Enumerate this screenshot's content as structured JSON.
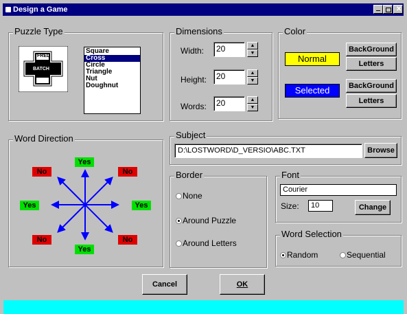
{
  "window": {
    "title": "Design a Game"
  },
  "puzzle_type": {
    "legend": "Puzzle Type",
    "preview_words": [
      "FRED",
      "BATCH"
    ],
    "options": [
      "Square",
      "Cross",
      "Circle",
      "Triangle",
      "Nut",
      "Doughnut"
    ],
    "selected": "Cross"
  },
  "dimensions": {
    "legend": "Dimensions",
    "width_label": "Width:",
    "width_value": "20",
    "height_label": "Height:",
    "height_value": "20",
    "words_label": "Words:",
    "words_value": "20"
  },
  "color": {
    "legend": "Color",
    "normal_label": "Normal",
    "selected_label": "Selected",
    "background_btn": "BackGround",
    "letters_btn": "Letters",
    "normal_color": "#ffff00",
    "selected_color": "#0000ff"
  },
  "word_direction": {
    "legend": "Word Direction",
    "up": "Yes",
    "up_left": "No",
    "up_right": "No",
    "left": "Yes",
    "right": "Yes",
    "down_left": "No",
    "down_right": "No",
    "down": "Yes"
  },
  "subject": {
    "legend": "Subject",
    "path": "D:\\LOSTWORD\\D_VERSIO\\ABC.TXT",
    "browse_btn": "Browse"
  },
  "border": {
    "legend": "Border",
    "options": [
      "None",
      "Around Puzzle",
      "Around  Letters"
    ],
    "selected": "Around Puzzle"
  },
  "font": {
    "legend": "Font",
    "name": "Courier",
    "size_label": "Size:",
    "size_value": "10",
    "change_btn": "Change"
  },
  "word_selection": {
    "legend": "Word Selection",
    "options": [
      "Random",
      "Sequential"
    ],
    "selected": "Random"
  },
  "buttons": {
    "cancel": "Cancel",
    "ok": "OK"
  },
  "arrow_color": "#0000ff"
}
